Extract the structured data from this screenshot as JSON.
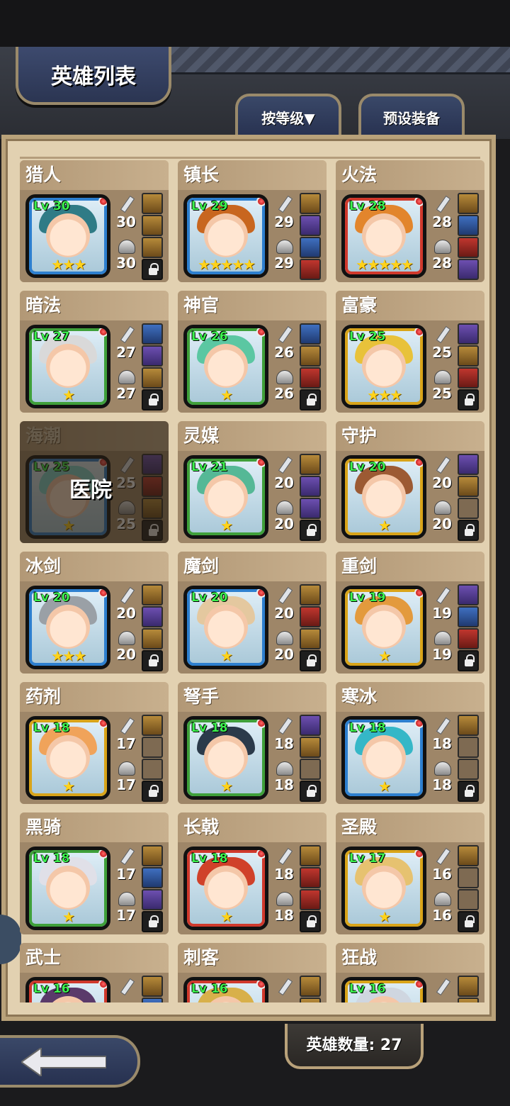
{
  "header": {
    "title": "英雄列表"
  },
  "tabs": [
    {
      "label": "按等级▼"
    },
    {
      "label": "预设装备"
    }
  ],
  "hospital_label": "医院",
  "footer": {
    "hero_count_label": "英雄数量: 27"
  },
  "colors": {
    "level_text": "#3cf04e",
    "star": "#ffd21a",
    "frame_blue": "#2d7fcf",
    "frame_green": "#3fa03a",
    "frame_red": "#d0392c",
    "frame_gold": "#d9a419"
  },
  "heroes": [
    {
      "name": "猎人",
      "level": "Lv 30",
      "attack": "30",
      "defense": "30",
      "stars": "★★★",
      "frame": "blue",
      "hair": "#2f7b86",
      "slots": [
        "gold",
        "gold",
        "gold",
        "lock"
      ]
    },
    {
      "name": "镇长",
      "level": "Lv 29",
      "attack": "29",
      "defense": "29",
      "stars": "★★★★★",
      "frame": "blue",
      "hair": "#c8661f",
      "slots": [
        "gold",
        "purple",
        "blue",
        "red"
      ]
    },
    {
      "name": "火法",
      "level": "Lv 28",
      "attack": "28",
      "defense": "28",
      "stars": "★★★★★",
      "frame": "red",
      "hair": "#e2852c",
      "slots": [
        "gold",
        "blue",
        "red",
        "purple"
      ]
    },
    {
      "name": "暗法",
      "level": "Lv 27",
      "attack": "27",
      "defense": "27",
      "stars": "★",
      "frame": "green",
      "hair": "#d9d9d9",
      "slots": [
        "blue",
        "purple",
        "gold",
        "lock"
      ]
    },
    {
      "name": "神官",
      "level": "Lv 26",
      "attack": "26",
      "defense": "26",
      "stars": "★",
      "frame": "green",
      "hair": "#5bc7a2",
      "slots": [
        "blue",
        "gold",
        "red",
        "lock"
      ]
    },
    {
      "name": "富豪",
      "level": "Lv 25",
      "attack": "25",
      "defense": "25",
      "stars": "★★★",
      "frame": "gold",
      "hair": "#e8c23a",
      "slots": [
        "purple",
        "gold",
        "red",
        "lock"
      ]
    },
    {
      "name": "海潮",
      "level": "Lv 25",
      "attack": "25",
      "defense": "25",
      "stars": "★",
      "frame": "blue",
      "hair": "#7fd6d0",
      "slots": [
        "purple",
        "red",
        "gold",
        "lock"
      ],
      "hospital": true
    },
    {
      "name": "灵媒",
      "level": "Lv 21",
      "attack": "20",
      "defense": "20",
      "stars": "★",
      "frame": "green",
      "hair": "#55b896",
      "slots": [
        "gold",
        "purple",
        "purple",
        "lock"
      ]
    },
    {
      "name": "守护",
      "level": "Lv 20",
      "attack": "20",
      "defense": "20",
      "stars": "★",
      "frame": "gold",
      "hair": "#9c5a33",
      "slots": [
        "purple",
        "gold",
        "empty",
        "lock"
      ]
    },
    {
      "name": "冰剑",
      "level": "Lv 20",
      "attack": "20",
      "defense": "20",
      "stars": "★★★",
      "frame": "blue",
      "hair": "#9aa0a6",
      "slots": [
        "gold",
        "purple",
        "gold",
        "lock"
      ]
    },
    {
      "name": "魔剑",
      "level": "Lv 20",
      "attack": "20",
      "defense": "20",
      "stars": "★",
      "frame": "blue",
      "hair": "#e4c89f",
      "slots": [
        "gold",
        "red",
        "gold",
        "lock"
      ]
    },
    {
      "name": "重剑",
      "level": "Lv 19",
      "attack": "19",
      "defense": "19",
      "stars": "★",
      "frame": "gold",
      "hair": "#e39a3d",
      "slots": [
        "purple",
        "blue",
        "red",
        "lock"
      ]
    },
    {
      "name": "药剂",
      "level": "Lv 18",
      "attack": "17",
      "defense": "17",
      "stars": "★",
      "frame": "gold",
      "hair": "#f0a35a",
      "slots": [
        "gold",
        "empty",
        "empty",
        "lock"
      ]
    },
    {
      "name": "弩手",
      "level": "Lv 18",
      "attack": "18",
      "defense": "18",
      "stars": "★",
      "frame": "green",
      "hair": "#2b3a4a",
      "slots": [
        "purple",
        "gold",
        "empty",
        "lock"
      ]
    },
    {
      "name": "寒冰",
      "level": "Lv 18",
      "attack": "18",
      "defense": "18",
      "stars": "★",
      "frame": "blue",
      "hair": "#35b7c7",
      "slots": [
        "gold",
        "empty",
        "empty",
        "lock"
      ]
    },
    {
      "name": "黑骑",
      "level": "Lv 18",
      "attack": "17",
      "defense": "17",
      "stars": "★",
      "frame": "green",
      "hair": "#e0e0e8",
      "slots": [
        "gold",
        "blue",
        "purple",
        "lock"
      ]
    },
    {
      "name": "长戟",
      "level": "Lv 18",
      "attack": "18",
      "defense": "18",
      "stars": "★",
      "frame": "red",
      "hair": "#d0412a",
      "slots": [
        "gold",
        "red",
        "red",
        "lock"
      ]
    },
    {
      "name": "圣殿",
      "level": "Lv 17",
      "attack": "16",
      "defense": "16",
      "stars": "★",
      "frame": "gold",
      "hair": "#e6c270",
      "slots": [
        "gold",
        "empty",
        "empty",
        "lock"
      ]
    },
    {
      "name": "武士",
      "level": "Lv 16",
      "attack": "",
      "defense": "",
      "stars": "",
      "frame": "red",
      "hair": "#5a3a6a",
      "slots": [
        "gold",
        "blue",
        "empty",
        "lock"
      ]
    },
    {
      "name": "刺客",
      "level": "Lv 16",
      "attack": "",
      "defense": "",
      "stars": "",
      "frame": "red",
      "hair": "#d8b04a",
      "slots": [
        "gold",
        "gold",
        "empty",
        "lock"
      ]
    },
    {
      "name": "狂战",
      "level": "Lv 16",
      "attack": "",
      "defense": "",
      "stars": "",
      "frame": "gold",
      "hair": "#cfd6e0",
      "slots": [
        "gold",
        "gold",
        "empty",
        "lock"
      ]
    }
  ]
}
